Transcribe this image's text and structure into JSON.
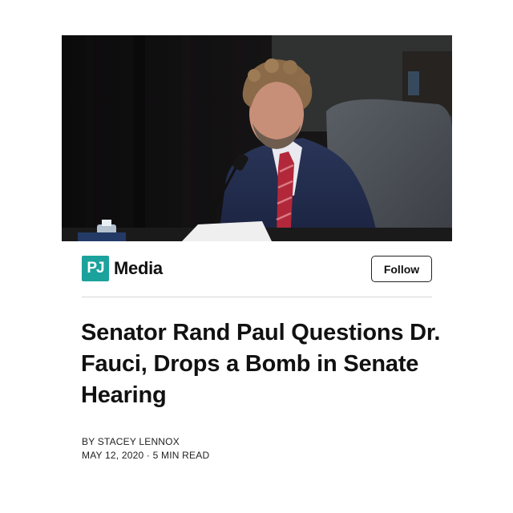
{
  "hero": {
    "image_subject": "man-at-hearing-photo"
  },
  "publisher": {
    "logo_text": "PJ",
    "name": "Media",
    "logo_color": "#1ba29c"
  },
  "actions": {
    "follow_label": "Follow"
  },
  "article": {
    "headline": "Senator Rand Paul Questions Dr. Fauci, Drops a Bomb in Senate Hearing",
    "byline": "BY STACEY LENNOX",
    "date": "MAY 12, 2020",
    "separator": "·",
    "read_time": "5 MIN READ"
  }
}
